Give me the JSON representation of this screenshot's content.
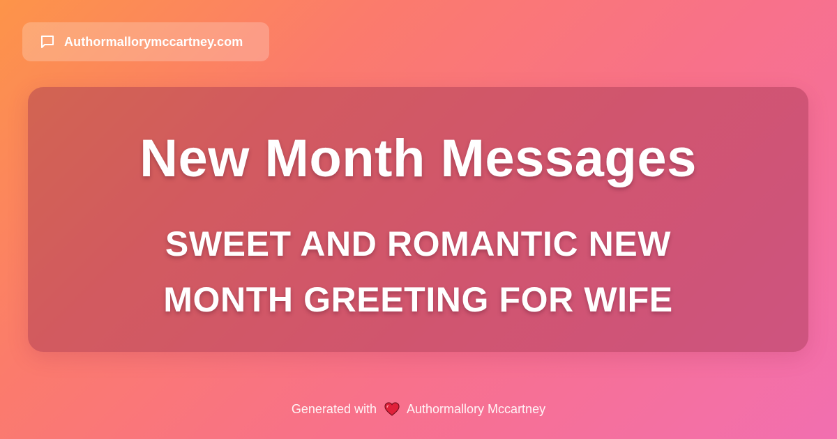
{
  "badge": {
    "icon": "message-icon",
    "site_name": "Authormallorymccartney.com"
  },
  "card": {
    "title": "New Month Messages",
    "subtitle": "SWEET AND ROMANTIC NEW MONTH GREETING FOR WIFE"
  },
  "footer": {
    "prefix": "Generated with",
    "icon": "heart-icon",
    "author": "Authormallory Mccartney"
  },
  "colors": {
    "gradient_start": "#fd9449",
    "gradient_end": "#f26fb0",
    "heart": "#e0213a",
    "text": "#ffffff"
  }
}
